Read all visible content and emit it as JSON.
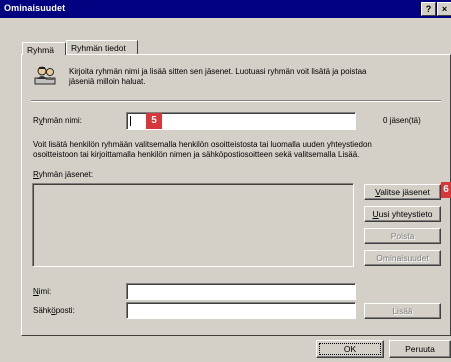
{
  "window": {
    "title": "Ominaisuudet",
    "help_label": "?",
    "close_label": "×"
  },
  "tabs": [
    {
      "label": "Ryhmä",
      "active": true
    },
    {
      "label": "Ryhmän tiedot",
      "active": false
    }
  ],
  "intro": {
    "icon": "group-people-icon",
    "text_line1": "Kirjoita ryhmän nimi ja lisää sitten sen jäsenet. Luotuasi ryhmän voit lisätä ja poistaa",
    "text_line2": "jäseniä milloin haluat."
  },
  "group_name": {
    "label": "Ryhmän nimi:",
    "value": "",
    "member_count": "0 jäsen(tä)"
  },
  "instructions": {
    "line1": "Voit lisätä henkilön ryhmään valitsemalla henkilön osoitteistosta tai luomalla uuden yhteystiedon",
    "line2": "osoitteistoon tai kirjoittamalla henkilön nimen ja sähköpostiosoitteen sekä valitsemalla Lisää."
  },
  "members": {
    "label": "Ryhmän jäsenet:",
    "items": []
  },
  "side_buttons": [
    {
      "label": "Valitse jäsenet",
      "enabled": true
    },
    {
      "label": "Uusi yhteystieto",
      "enabled": true
    },
    {
      "label": "Poista",
      "enabled": false
    },
    {
      "label": "Ominaisuudet",
      "enabled": false
    }
  ],
  "name_field": {
    "label": "Nimi:",
    "value": ""
  },
  "email_field": {
    "label": "Sähköposti:",
    "value": ""
  },
  "add_button": {
    "label": "Lisää",
    "enabled": false
  },
  "footer": {
    "ok_label": "OK",
    "cancel_label": "Peruuta"
  },
  "annotations": [
    {
      "number": "5",
      "color": "#d6373b"
    },
    {
      "number": "6",
      "color": "#d6373b"
    }
  ]
}
